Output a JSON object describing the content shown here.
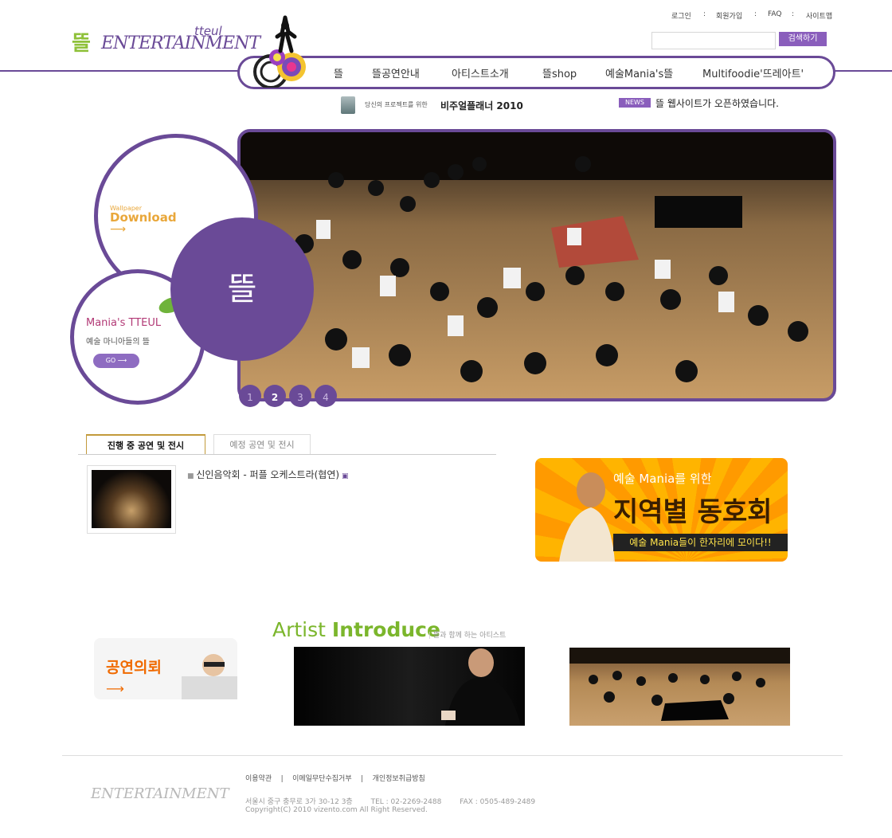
{
  "header": {
    "logo_tteul": "tteul",
    "logo_entertainment": "ENTERTAINMENT",
    "logo_hangul": "뜰",
    "top_links": [
      "로그인",
      "회원가입",
      "FAQ",
      "사이트맵"
    ],
    "top_sep": ":",
    "search": {
      "placeholder": "",
      "button": "검색하기"
    }
  },
  "nav": {
    "items": [
      "뜰",
      "뜰공연안내",
      "아티스트소개",
      "뜰shop",
      "예술Mania's뜰",
      "Multifoodie'뜨레아트'"
    ]
  },
  "news": {
    "planner_small": "당신의 프로젝트를 위한",
    "planner_big": "비주얼플래너 2010",
    "badge": "NEWS",
    "text": "뜰 웹사이트가 오픈하였습니다."
  },
  "hero": {
    "wallpaper_small": "Wallpaper",
    "wallpaper_big": "Download",
    "arrow": "⟶",
    "mania_title": "Mania's TTEUL",
    "mania_sub": "예술 마니아들의 뜰",
    "go": "GO ⟶",
    "emblem": "뜰",
    "pages": [
      "1",
      "2",
      "3",
      "4"
    ],
    "active_page": 2
  },
  "performances": {
    "tabs": [
      "진행 중 공연 및 전시",
      "예정 공연 및 전시"
    ],
    "active_tab": 0,
    "items": [
      "신인음악회 - 퍼플 오케스트라(협연)"
    ]
  },
  "banner": {
    "sub": "예술 Mania를 위한",
    "main": "지역별 동호회",
    "bar": "예술 Mania들이 한자리에 모이다!!"
  },
  "artist": {
    "title_a": "Artist ",
    "title_b": "Introduce",
    "sub": "뜰과 함께 하는 아티스트",
    "request": "공연의뢰",
    "arrow": "⟶"
  },
  "footer": {
    "logo": "ENTERTAINMENT",
    "links": [
      "이용약관",
      "이메일무단수집거부",
      "개인정보취급방침"
    ],
    "sep": "|",
    "address": "서울시 중구 충무로 3가 30-12 3층",
    "tel": "TEL : 02-2269-2488",
    "fax": "FAX : 0505-489-2489",
    "copyright": "Copyright(C) 2010 vizento.com All Right Reserved."
  },
  "colors": {
    "brand_purple": "#6a4a97",
    "accent_green": "#7bb62c",
    "orange": "#f06a00"
  }
}
